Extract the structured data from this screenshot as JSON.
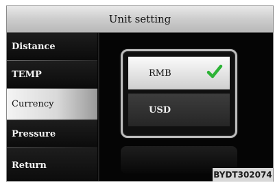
{
  "header": {
    "title": "Unit setting"
  },
  "sidebar": {
    "items": [
      {
        "label": "Distance"
      },
      {
        "label": "TEMP"
      },
      {
        "label": "Currency",
        "selected": true
      },
      {
        "label": "Pressure"
      },
      {
        "label": "Return"
      }
    ]
  },
  "options": {
    "items": [
      {
        "label": "RMB",
        "selected": true,
        "icon": "check-icon"
      },
      {
        "label": "USD"
      }
    ]
  },
  "colors": {
    "check": "#2db336",
    "selected_bg": "#e6e6e6",
    "screen_bg": "#050505"
  },
  "watermark": {
    "code": "BYDT302074"
  }
}
